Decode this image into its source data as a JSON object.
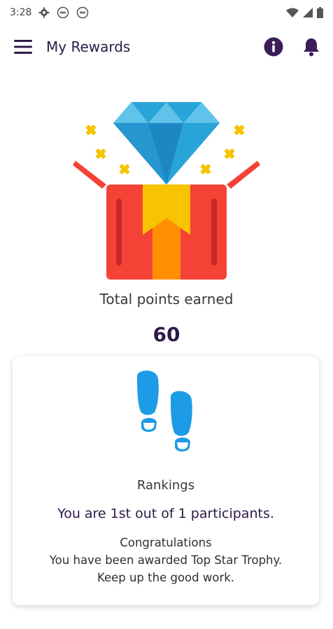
{
  "status_bar": {
    "time": "3:28"
  },
  "app_bar": {
    "title": "My Rewards"
  },
  "summary": {
    "points_label": "Total points earned",
    "points_value": "60"
  },
  "ranking": {
    "title": "Rankings",
    "position_text": "You are 1st out of 1 participants.",
    "message_lines": [
      "Congratulations",
      "You have been awarded Top Star Trophy.",
      "Keep up the good work."
    ]
  },
  "icons": {
    "menu": "hamburger-menu-icon",
    "info": "info-icon",
    "notifications": "bell-icon",
    "hero": "gift-box-diamond-illustration",
    "ranking": "footprints-icon"
  },
  "colors": {
    "primary": "#3b1d5a",
    "diamond": "#29a4d8",
    "box": "#f44336",
    "ribbon": "#f8b400",
    "sparkle": "#f6c400",
    "footprints": "#1e9be6"
  }
}
